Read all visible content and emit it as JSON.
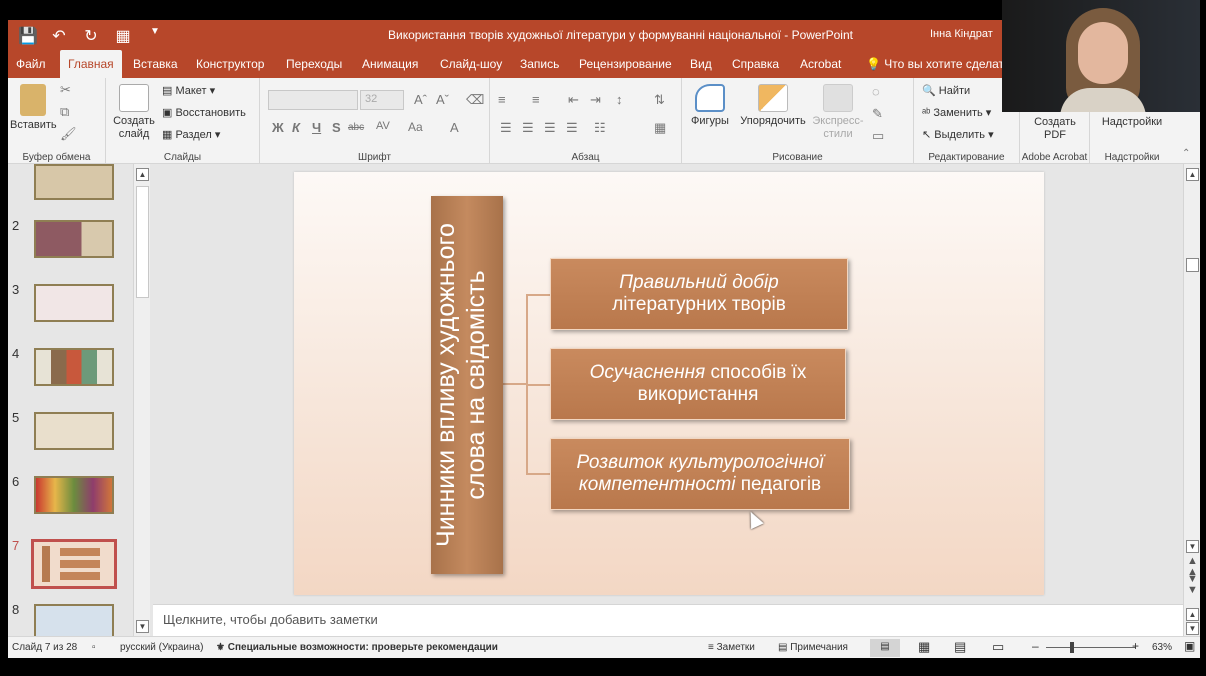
{
  "titlebar": {
    "save_icon": "save-icon",
    "undo_icon": "undo-icon",
    "redo_icon": "redo-icon",
    "present_icon": "present-icon",
    "customize_icon": "customize-icon",
    "title": "Використання творів художньої літератури у формуванні національної  -  PowerPoint",
    "user": "Інна Кіндрат"
  },
  "tabs": [
    "Файл",
    "Главная",
    "Вставка",
    "Конструктор",
    "Переходы",
    "Анимация",
    "Слайд-шоу",
    "Запись",
    "Рецензирование",
    "Вид",
    "Справка",
    "Acrobat"
  ],
  "active_tab": "Главная",
  "tell_me": "Что вы хотите сделать",
  "ribbon": {
    "clipboard": {
      "paste": "Вставить",
      "label": "Буфер обмена"
    },
    "slides": {
      "new_slide": "Создать слайд",
      "layout": "Макет",
      "reset": "Восстановить",
      "section": "Раздел",
      "label": "Слайды"
    },
    "font": {
      "size": "32",
      "bold": "Ж",
      "italic": "К",
      "underline": "Ч",
      "shadow": "S",
      "strike": "abc",
      "spacing": "AV",
      "case": "Aa",
      "label": "Шрифт"
    },
    "paragraph": {
      "label": "Абзац"
    },
    "drawing": {
      "shapes": "Фигуры",
      "arrange": "Упорядочить",
      "quick_styles": "Экспресс-стили",
      "label": "Рисование"
    },
    "editing": {
      "find": "Найти",
      "replace": "Заменить",
      "select": "Выделить",
      "label": "Редактирование"
    },
    "acrobat": {
      "create_pdf": "Создать PDF",
      "label": "Adobe Acrobat"
    },
    "addins": {
      "addins": "Надстройки",
      "label": "Надстройки"
    }
  },
  "thumbnails": [
    {
      "num": "",
      "selected": false
    },
    {
      "num": "2",
      "selected": false
    },
    {
      "num": "3",
      "selected": false
    },
    {
      "num": "4",
      "selected": false
    },
    {
      "num": "5",
      "selected": false
    },
    {
      "num": "6",
      "selected": false
    },
    {
      "num": "7",
      "selected": true
    },
    {
      "num": "8",
      "selected": false
    }
  ],
  "slide": {
    "vertical_title": "Чинники впливу художнього слова на свідомість",
    "vertical_line1": "Чинники впливу художнього",
    "vertical_line2": "слова на свідомість",
    "box1_italic": "Правильний добір",
    "box1_rest": "літературних творів",
    "box2_italic": "Осучаснення",
    "box2_rest": " способів їх",
    "box2_line2": "використання",
    "box3_italic1": "Розвиток культурологічної",
    "box3_italic2": "компетентності",
    "box3_rest": " педагогів",
    "colors": {
      "bar": "#b67a50",
      "box": "#c4855a",
      "connector": "#d7a888"
    }
  },
  "notes_placeholder": "Щелкните, чтобы добавить заметки",
  "status": {
    "slide_of": "Слайд 7 из 28",
    "language": "русский (Украина)",
    "accessibility": "Специальные возможности: проверьте рекомендации",
    "notes": "Заметки",
    "comments": "Примечания",
    "zoom": "63%",
    "zoom_minus": "–",
    "zoom_plus": "+"
  }
}
